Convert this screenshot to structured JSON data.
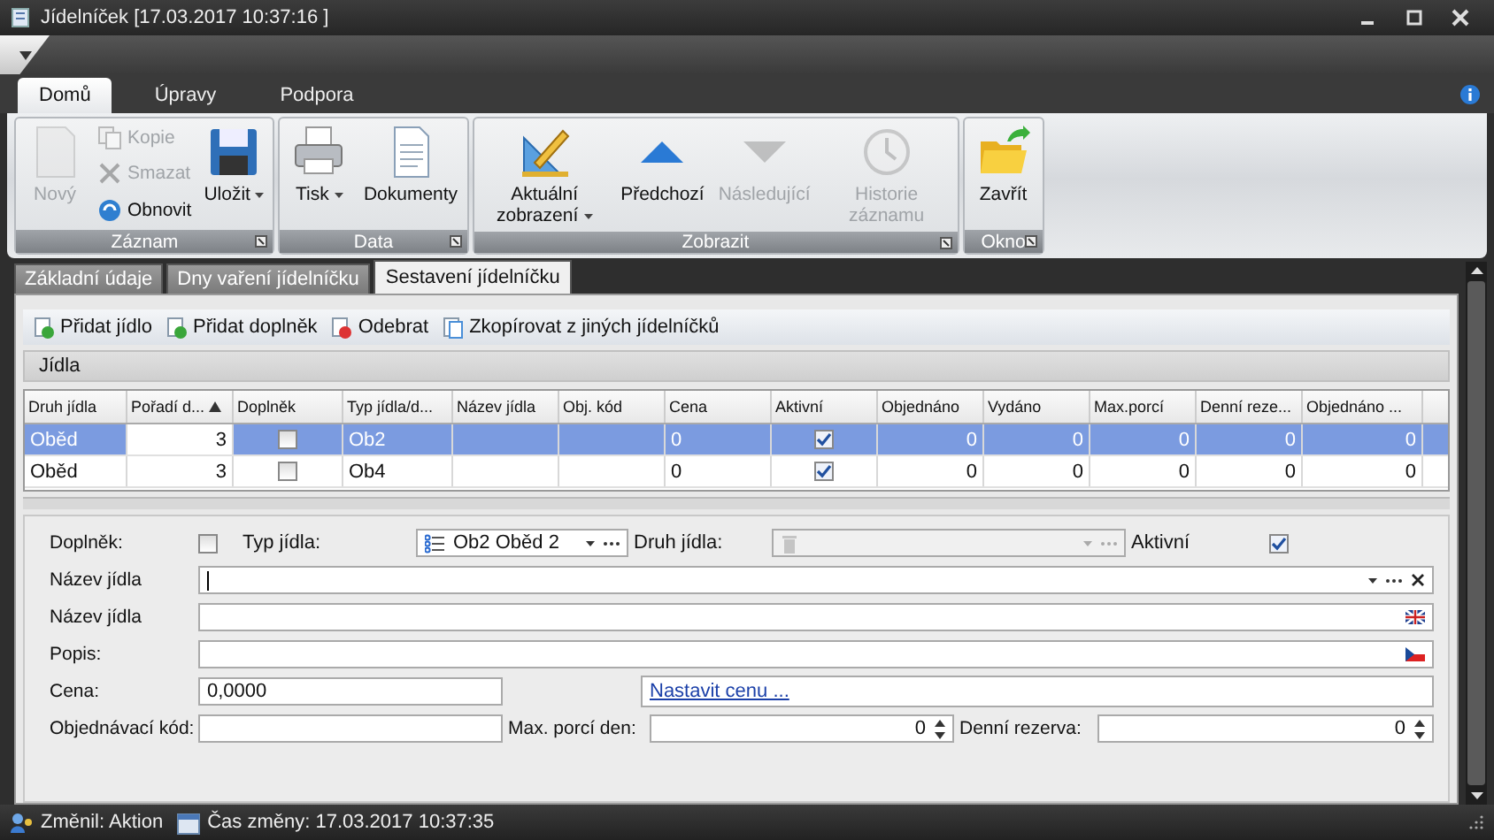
{
  "window": {
    "title": "Jídelníček [17.03.2017 10:37:16 ]"
  },
  "ribbon": {
    "tabs": [
      {
        "label": "Domů",
        "selected": true
      },
      {
        "label": "Úpravy",
        "selected": false
      },
      {
        "label": "Podpora",
        "selected": false
      }
    ],
    "groups": [
      {
        "label": "Záznam",
        "items": [
          {
            "kind": "large",
            "label": "Nový",
            "disabled": true,
            "dropdown": false
          },
          {
            "kind": "stack",
            "buttons": [
              {
                "label": "Kopie",
                "disabled": true
              },
              {
                "label": "Smazat",
                "disabled": true
              },
              {
                "label": "Obnovit",
                "disabled": false
              }
            ]
          },
          {
            "kind": "large",
            "label": "Uložit",
            "disabled": false,
            "dropdown": true
          }
        ]
      },
      {
        "label": "Data",
        "items": [
          {
            "kind": "large",
            "label": "Tisk",
            "disabled": false,
            "dropdown": true
          },
          {
            "kind": "large",
            "label": "Dokumenty",
            "disabled": false,
            "dropdown": false
          }
        ]
      },
      {
        "label": "Zobrazit",
        "items": [
          {
            "kind": "large",
            "label": "Aktuální zobrazení",
            "disabled": false,
            "dropdown": true
          },
          {
            "kind": "large",
            "label": "Předchozí",
            "disabled": false,
            "dropdown": false
          },
          {
            "kind": "large",
            "label": "Následující",
            "disabled": true,
            "dropdown": false
          },
          {
            "kind": "large",
            "label": "Historie záznamu",
            "disabled": true,
            "dropdown": false
          }
        ]
      },
      {
        "label": "Okno",
        "items": [
          {
            "kind": "large",
            "label": "Zavřít",
            "disabled": false,
            "dropdown": false
          }
        ]
      }
    ]
  },
  "page_tabs": [
    {
      "label": "Základní údaje",
      "selected": false
    },
    {
      "label": "Dny vaření jídelníčku",
      "selected": false
    },
    {
      "label": "Sestavení jídelníčku",
      "selected": true
    }
  ],
  "toolbar": [
    "Přidat jídlo",
    "Přidat doplněk",
    "Odebrat",
    "Zkopírovat z jiných jídelníčků"
  ],
  "grid": {
    "title": "Jídla",
    "columns": [
      {
        "label": "Druh jídla",
        "sorted": false
      },
      {
        "label": "Pořadí d...",
        "sorted": true
      },
      {
        "label": "Doplněk",
        "sorted": false
      },
      {
        "label": "Typ jídla/d...",
        "sorted": false
      },
      {
        "label": "Název jídla",
        "sorted": false
      },
      {
        "label": "Obj. kód",
        "sorted": false
      },
      {
        "label": "Cena",
        "sorted": false
      },
      {
        "label": "Aktivní",
        "sorted": false
      },
      {
        "label": "Objednáno",
        "sorted": false
      },
      {
        "label": "Vydáno",
        "sorted": false
      },
      {
        "label": "Max.porcí",
        "sorted": false
      },
      {
        "label": "Denní reze...",
        "sorted": false
      },
      {
        "label": "Objednáno ...",
        "sorted": false
      }
    ],
    "rows": [
      {
        "selected": true,
        "cells": [
          {
            "kind": "text",
            "text": "Oběd"
          },
          {
            "kind": "number",
            "text": "3"
          },
          {
            "kind": "check",
            "checked": false
          },
          {
            "kind": "text",
            "text": "Ob2"
          },
          {
            "kind": "empty"
          },
          {
            "kind": "empty"
          },
          {
            "kind": "text",
            "text": "0"
          },
          {
            "kind": "check",
            "checked": true
          },
          {
            "kind": "number",
            "text": "0"
          },
          {
            "kind": "number",
            "text": "0"
          },
          {
            "kind": "number",
            "text": "0"
          },
          {
            "kind": "number",
            "text": "0"
          },
          {
            "kind": "number",
            "text": "0"
          }
        ]
      },
      {
        "selected": false,
        "cells": [
          {
            "kind": "text",
            "text": "Oběd"
          },
          {
            "kind": "number",
            "text": "3"
          },
          {
            "kind": "check",
            "checked": false
          },
          {
            "kind": "text",
            "text": "Ob4"
          },
          {
            "kind": "empty"
          },
          {
            "kind": "empty"
          },
          {
            "kind": "text",
            "text": "0"
          },
          {
            "kind": "check",
            "checked": true
          },
          {
            "kind": "number",
            "text": "0"
          },
          {
            "kind": "number",
            "text": "0"
          },
          {
            "kind": "number",
            "text": "0"
          },
          {
            "kind": "number",
            "text": "0"
          },
          {
            "kind": "number",
            "text": "0"
          }
        ]
      }
    ]
  },
  "form": {
    "supplement": {
      "label": "Doplněk:",
      "checked": false
    },
    "type": {
      "label": "Typ jídla:",
      "value": "Ob2 Oběd 2"
    },
    "kind": {
      "label": "Druh jídla:",
      "disabled": true
    },
    "active": {
      "label": "Aktivní",
      "checked": true
    },
    "name": {
      "label": "Název jídla"
    },
    "name_en": {
      "label": "Název jídla"
    },
    "description": {
      "label": "Popis:"
    },
    "price": {
      "label": "Cena:",
      "value": "0,0000",
      "link": "Nastavit cenu ..."
    },
    "order_code": {
      "label": "Objednávací kód:"
    },
    "max_portions": {
      "label": "Max. porcí den:",
      "value": "0"
    },
    "daily_reserve": {
      "label": "Denní rezerva:",
      "value": "0"
    }
  },
  "status_bar": [
    "Změnil: Aktion",
    "Čas změny: 17.03.2017 10:37:35"
  ]
}
